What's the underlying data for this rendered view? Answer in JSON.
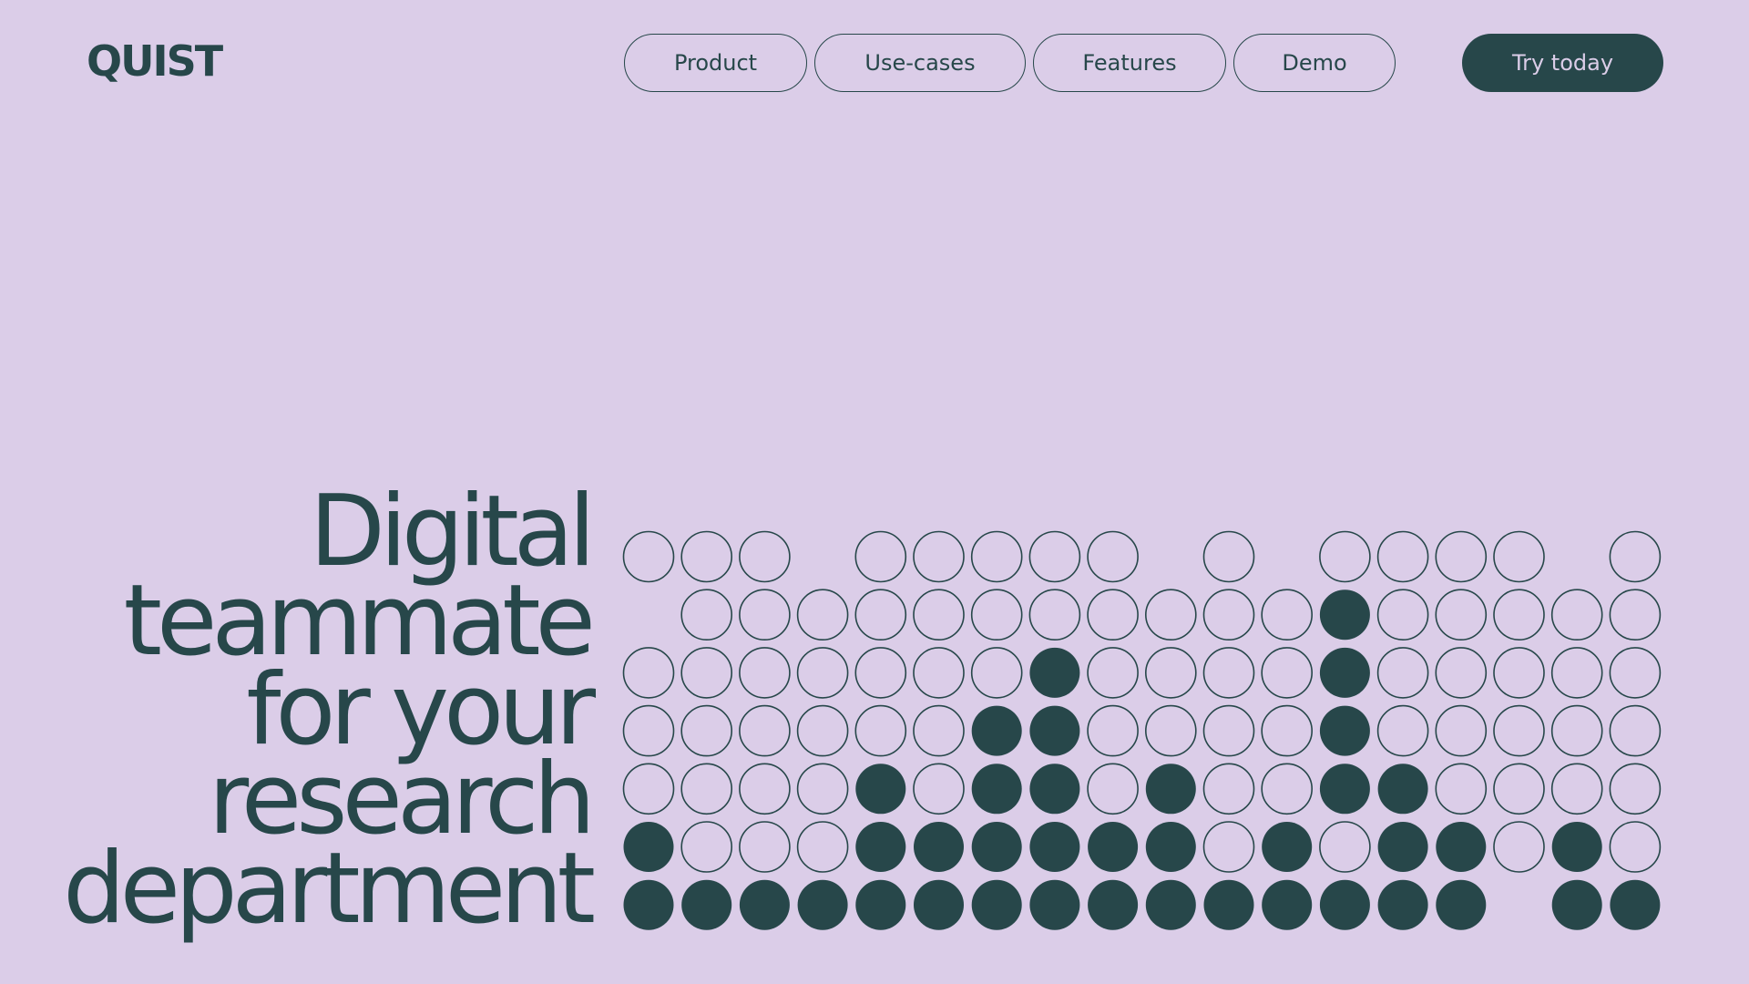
{
  "brand": {
    "logo_text": "QUIST"
  },
  "nav": {
    "items": [
      {
        "label": "Product"
      },
      {
        "label": "Use-cases"
      },
      {
        "label": "Features"
      },
      {
        "label": "Demo"
      }
    ],
    "cta_label": "Try today"
  },
  "hero": {
    "lines": [
      "Digital",
      "teammate",
      "for your",
      "research",
      "department"
    ]
  },
  "colors": {
    "background": "#dbcde8",
    "primary": "#27474a"
  },
  "dot_grid": {
    "legend": "o = outlined circle, x = filled circle, . = empty",
    "rows": [
      "ooo.ooooo.o.oooo.o",
      ".oooooooooooxooooo",
      "oooooooxooooxooooo",
      "ooooooxxooooxooooo",
      "ooooxoxxoxooxxoooo",
      "xoooxxxxxxoxoxxoxo",
      "xxxxxxxxxxxxxxx.xx"
    ]
  }
}
